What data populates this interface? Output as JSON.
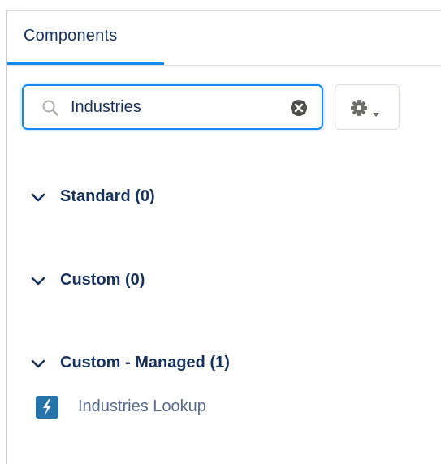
{
  "tabs": [
    {
      "label": "Components",
      "active": true
    }
  ],
  "search": {
    "value": "Industries",
    "icon": "search-icon",
    "clear_icon": "clear-icon"
  },
  "settings_button": {
    "icon": "gear-icon",
    "caret": "caret-down-icon"
  },
  "sections": [
    {
      "label": "Standard (0)",
      "expanded": true
    },
    {
      "label": "Custom (0)",
      "expanded": true
    },
    {
      "label": "Custom - Managed (1)",
      "expanded": true,
      "items": [
        {
          "label": "Industries Lookup",
          "icon": "lightning-icon"
        }
      ]
    }
  ],
  "colors": {
    "accent": "#1589ee",
    "text": "#16325c",
    "muted": "#54698d",
    "component_icon_bg": "#2574a9"
  }
}
